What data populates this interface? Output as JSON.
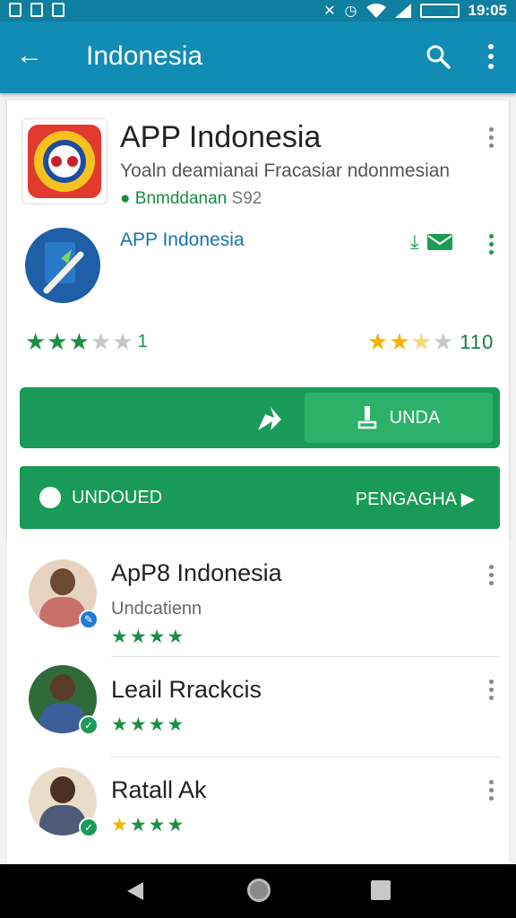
{
  "status_bar": {
    "time": "19:05"
  },
  "app_bar": {
    "title": "Indonesia"
  },
  "app": {
    "title": "APP Indonesia",
    "subtitle": "Yoaln deamianai Fracasiar ndonmesian",
    "developer": "Bnmddanan",
    "size": "S92"
  },
  "related": {
    "title": "APP Indonesia"
  },
  "ratings": {
    "left": {
      "stars": 3,
      "value": "1"
    },
    "right": {
      "stars": 2,
      "value": "110"
    }
  },
  "buttons": {
    "install_label": "UNDA",
    "secondary_left_label": "UNDOUED",
    "secondary_right_label": "PENGAGHA"
  },
  "list_items": [
    {
      "title": "ApP8 Indonesia",
      "subtitle": "Undcatienn",
      "stars": 4
    },
    {
      "title": "Leail Rrackcis",
      "subtitle": "",
      "stars": 4
    },
    {
      "title": "Ratall Ak",
      "subtitle": "",
      "stars": 4
    }
  ],
  "icons": {
    "status_left": [
      "alert-icon",
      "image-icon",
      "sd-card-icon"
    ],
    "status_right": [
      "mute-icon",
      "alarm-icon",
      "wifi-icon",
      "signal-icon",
      "battery-icon"
    ],
    "app_bar": [
      "back-arrow-icon",
      "search-icon",
      "more-vert-icon"
    ],
    "nav": [
      "nav-back-icon",
      "nav-home-icon",
      "nav-recents-icon"
    ]
  },
  "colors": {
    "app_bar": "#118cb4",
    "status_bar": "#0f7fa0",
    "primary_green": "#1b9b58",
    "install_green": "#2db169",
    "star_green": "#1b8f45",
    "star_gold": "#f4b400",
    "link_blue": "#1a73a8"
  }
}
